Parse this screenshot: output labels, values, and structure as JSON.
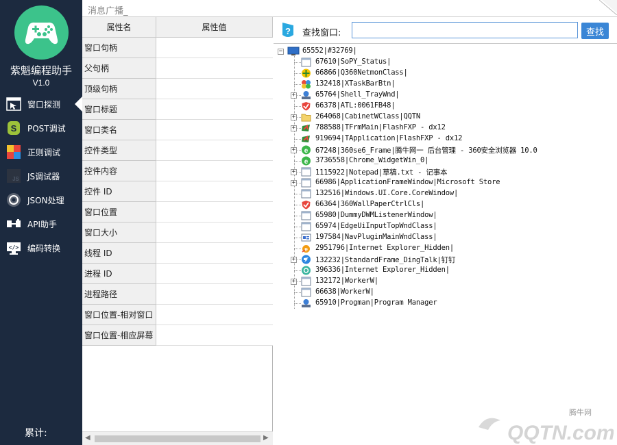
{
  "app": {
    "name": "紫魁编程助手",
    "version": "V1.0",
    "total_label": "累计:"
  },
  "sidebar": {
    "items": [
      {
        "label": "窗口探测",
        "icon": "window-probe-icon",
        "active": true
      },
      {
        "label": "POST调试",
        "icon": "post-debug-icon",
        "active": false
      },
      {
        "label": "正则调试",
        "icon": "regex-debug-icon",
        "active": false
      },
      {
        "label": "JS调试器",
        "icon": "js-debugger-icon",
        "active": false
      },
      {
        "label": "JSON处理",
        "icon": "json-icon",
        "active": false
      },
      {
        "label": "API助手",
        "icon": "api-icon",
        "active": false
      },
      {
        "label": "编码转换",
        "icon": "encoding-icon",
        "active": false
      }
    ]
  },
  "broadcast": {
    "text": "消息广播_"
  },
  "property_grid": {
    "headers": [
      "属性名",
      "属性值"
    ],
    "rows": [
      {
        "name": "窗口句柄",
        "value": ""
      },
      {
        "name": "父句柄",
        "value": ""
      },
      {
        "name": "顶级句柄",
        "value": ""
      },
      {
        "name": "窗口标题",
        "value": ""
      },
      {
        "name": "窗口类名",
        "value": ""
      },
      {
        "name": "控件类型",
        "value": ""
      },
      {
        "name": "控件内容",
        "value": ""
      },
      {
        "name": "控件 ID",
        "value": ""
      },
      {
        "name": "窗口位置",
        "value": ""
      },
      {
        "name": "窗口大小",
        "value": ""
      },
      {
        "name": "线程 ID",
        "value": ""
      },
      {
        "name": "进程 ID",
        "value": ""
      },
      {
        "name": "进程路径",
        "value": ""
      },
      {
        "name": "窗口位置-相对窗口",
        "value": ""
      },
      {
        "name": "窗口位置-相应屏幕",
        "value": ""
      }
    ]
  },
  "search": {
    "label": "查找窗口:",
    "value": "",
    "placeholder": "",
    "button_label": "查找"
  },
  "window_tree": {
    "root": {
      "text": "65552|#32769|",
      "icon": "desktop-icon",
      "expanded": true
    },
    "nodes": [
      {
        "text": "67610|SoPY_Status|",
        "icon": "window-icon",
        "expandable": false
      },
      {
        "text": "66866|Q360NetmonClass|",
        "icon": "netmon-icon",
        "expandable": false
      },
      {
        "text": "132418|XTaskBarBtn|",
        "icon": "colorful-app-icon",
        "expandable": false
      },
      {
        "text": "65764|Shell_TrayWnd|",
        "icon": "user-shell-icon",
        "expandable": true
      },
      {
        "text": "66378|ATL:0061FB48|",
        "icon": "security-shield-icon",
        "expandable": false
      },
      {
        "text": "264068|CabinetWClass|QQTN",
        "icon": "folder-icon",
        "expandable": true
      },
      {
        "text": "788588|TFrmMain|FlashFXP - dx12",
        "icon": "flashfxp-icon",
        "expandable": true
      },
      {
        "text": "919694|TApplication|FlashFXP - dx12",
        "icon": "flashfxp-icon",
        "expandable": false
      },
      {
        "text": "67248|360se6_Frame|腾牛网一 后台管理 - 360安全浏览器 10.0",
        "icon": "browser-360-icon",
        "expandable": true
      },
      {
        "text": "3736558|Chrome_WidgetWin_0|",
        "icon": "browser-360-icon",
        "expandable": false
      },
      {
        "text": "1115922|Notepad|草稿.txt - 记事本",
        "icon": "window-icon",
        "expandable": true
      },
      {
        "text": "66986|ApplicationFrameWindow|Microsoft Store",
        "icon": "window-icon",
        "expandable": true
      },
      {
        "text": "132516|Windows.UI.Core.CoreWindow|",
        "icon": "window-icon",
        "expandable": false
      },
      {
        "text": "66364|360WallPaperCtrlCls|",
        "icon": "security-shield-icon",
        "expandable": false
      },
      {
        "text": "65980|DummyDWMListenerWindow|",
        "icon": "window-icon",
        "expandable": false
      },
      {
        "text": "65974|EdgeUiInputTopWndClass|",
        "icon": "window-icon",
        "expandable": false
      },
      {
        "text": "197584|NavPluginMainWndClass|",
        "icon": "nav-plugin-icon",
        "expandable": false
      },
      {
        "text": "2951796|Internet Explorer_Hidden|",
        "icon": "ie-icon",
        "expandable": false
      },
      {
        "text": "132232|StandardFrame_DingTalk|钉钉",
        "icon": "dingtalk-icon",
        "expandable": true
      },
      {
        "text": "396336|Internet Explorer_Hidden|",
        "icon": "green-app-icon",
        "expandable": false
      },
      {
        "text": "132172|WorkerW|",
        "icon": "window-icon",
        "expandable": true
      },
      {
        "text": "66638|WorkerW|",
        "icon": "window-icon",
        "expandable": false
      },
      {
        "text": "65910|Progman|Program Manager",
        "icon": "user-shell-icon",
        "expandable": false
      }
    ]
  },
  "watermark": {
    "brand": "腾牛网",
    "logo_text": "QQTN.com"
  },
  "colors": {
    "sidebar_bg": "#1c2a3f",
    "logo_green": "#3cc38b",
    "accent_blue": "#3a86d6",
    "grid_header_bg": "#f0f0f0"
  }
}
